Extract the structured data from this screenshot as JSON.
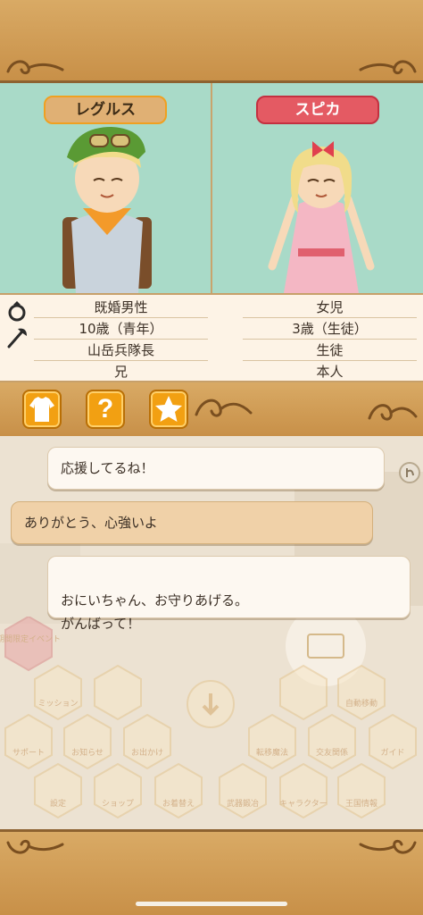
{
  "characters": {
    "left": {
      "name": "レグルス",
      "info": [
        "既婚男性",
        "10歳（青年）",
        "山岳兵隊長",
        "兄"
      ]
    },
    "right": {
      "name": "スピカ",
      "info": [
        "女児",
        "3歳（生徒）",
        "生徒",
        "本人"
      ]
    }
  },
  "info_icons": [
    "ring-icon",
    "axe-icon"
  ],
  "toolbar": {
    "buttons": [
      "outfit-icon",
      "question-icon",
      "star-icon"
    ],
    "question_glyph": "?"
  },
  "dialogue": [
    {
      "text": "応援してるね！",
      "style": "light"
    },
    {
      "text": "ありがとう、心強いよ",
      "style": "dark"
    },
    {
      "text": "おにいちゃん、お守りあげる。\nがんばって！",
      "style": "light"
    }
  ],
  "background_menu": {
    "event_label": "期間限定イベント",
    "items": [
      "ミッション",
      "",
      "",
      "自動移動",
      "サポート",
      "お知らせ",
      "お出かけ",
      "転移魔法",
      "交友関係",
      "ガイド",
      "設定",
      "ショップ",
      "お着替え",
      "武器鍛冶",
      "キャラクター",
      "王国情報"
    ]
  },
  "colors": {
    "frame": "#c89048",
    "profile_bg": "#a9dac8",
    "tag_left": "#e0b074",
    "tag_right": "#e45a63",
    "button": "#f2a012"
  }
}
